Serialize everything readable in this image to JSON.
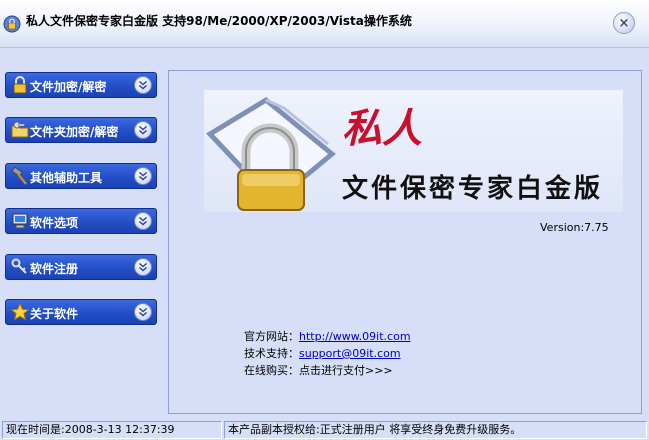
{
  "window": {
    "title": "私人文件保密专家白金版  支持98/Me/2000/XP/2003/Vista操作系统",
    "close_glyph": "×"
  },
  "sidebar": {
    "items": [
      {
        "label": "文件加密/解密",
        "icon": "lock-icon"
      },
      {
        "label": "文件夹加密/解密",
        "icon": "folder-key-icon"
      },
      {
        "label": "其他辅助工具",
        "icon": "hammer-icon"
      },
      {
        "label": "软件选项",
        "icon": "computer-icon"
      },
      {
        "label": "软件注册",
        "icon": "key-icon"
      },
      {
        "label": "关于软件",
        "icon": "star-icon"
      }
    ]
  },
  "logo": {
    "title": "私人",
    "subtitle": "文件保密专家白金版"
  },
  "main": {
    "version": "Version:7.75",
    "website_label": "官方网站：",
    "website_url": "http://www.09it.com",
    "support_label": "技术支持：",
    "support_email": "support@09it.com",
    "buy_label": "在线购买：",
    "buy_link": "点击进行支付>>>"
  },
  "status": {
    "time": "现在时间是:2008-3-13 12:37:39",
    "license": "本产品副本授权给:正式注册用户   将享受终身免费升级服务。"
  },
  "colors": {
    "nav_blue": "#2450c8",
    "background": "#d6dff7",
    "logo_red": "#c8102e"
  }
}
